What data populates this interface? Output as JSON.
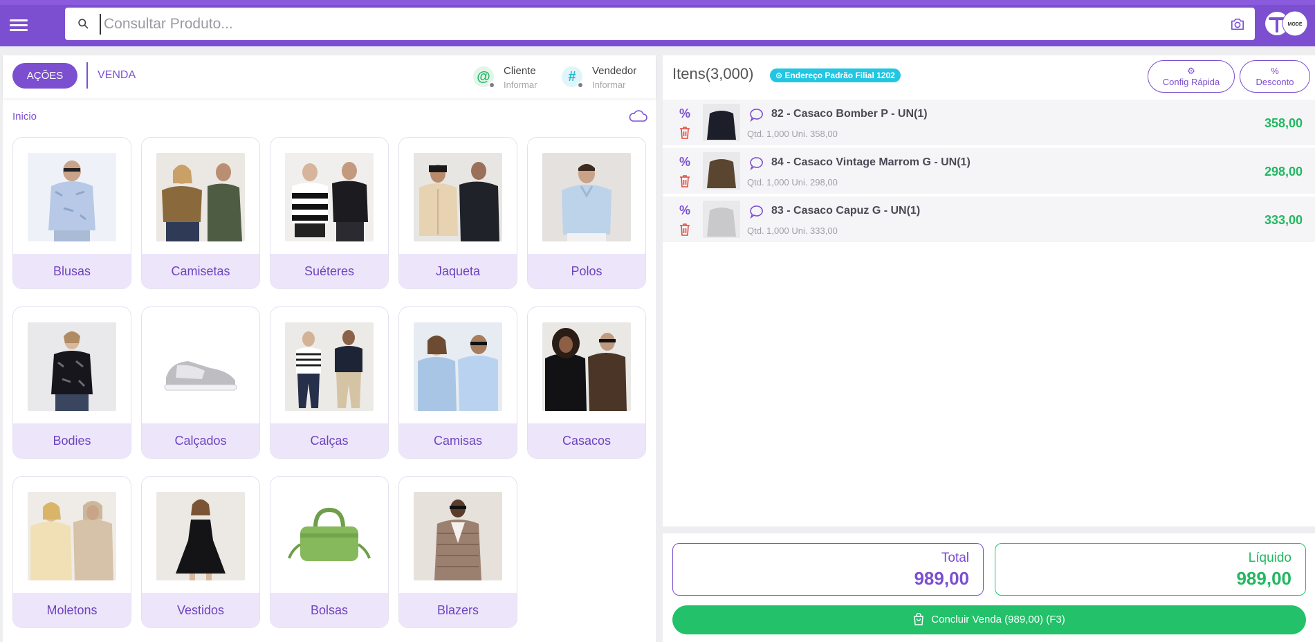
{
  "search": {
    "placeholder": "Consultar Produto..."
  },
  "brand": {
    "logo_text": "MODE"
  },
  "toolbar": {
    "actions_label": "AÇÕES",
    "sale_tab": "VENDA",
    "customer": {
      "title": "Cliente",
      "value": "Informar"
    },
    "seller": {
      "title": "Vendedor",
      "value": "Informar"
    }
  },
  "breadcrumb": "Inicio",
  "categories": [
    {
      "label": "Blusas",
      "icon": "blouse-photo"
    },
    {
      "label": "Camisetas",
      "icon": "tshirt-photo"
    },
    {
      "label": "Suéteres",
      "icon": "sweater-photo"
    },
    {
      "label": "Jaqueta",
      "icon": "jacket-photo"
    },
    {
      "label": "Polos",
      "icon": "polo-photo"
    },
    {
      "label": "Bodies",
      "icon": "bodysuit-photo"
    },
    {
      "label": "Calçados",
      "icon": "sneaker-photo"
    },
    {
      "label": "Calças",
      "icon": "pants-photo"
    },
    {
      "label": "Camisas",
      "icon": "shirt-photo"
    },
    {
      "label": "Casacos",
      "icon": "coat-photo"
    },
    {
      "label": "Moletons",
      "icon": "hoodie-photo"
    },
    {
      "label": "Vestidos",
      "icon": "dress-photo"
    },
    {
      "label": "Bolsas",
      "icon": "bag-photo"
    },
    {
      "label": "Blazers",
      "icon": "blazer-photo"
    }
  ],
  "cart": {
    "title": "Itens(3,000)",
    "address_badge": "Endereço Padrão Filial 1202",
    "quick_config_label": "Config Rápida",
    "discount_label": "Desconto",
    "items": [
      {
        "name": "82 - Casaco Bomber P - UN(1)",
        "meta": "Qtd. 1,000  Uni. 358,00",
        "price": "358,00",
        "thumb_color": "#1c1f2a"
      },
      {
        "name": "84 - Casaco Vintage Marrom G - UN(1)",
        "meta": "Qtd. 1,000  Uni. 298,00",
        "price": "298,00",
        "thumb_color": "#5a4630"
      },
      {
        "name": "83 - Casaco Capuz G - UN(1)",
        "meta": "Qtd. 1,000  Uni. 333,00",
        "price": "333,00",
        "thumb_color": "#c9c9cc"
      }
    ]
  },
  "totals": {
    "total_label": "Total",
    "total_value": "989,00",
    "net_label": "Líquido",
    "net_value": "989,00",
    "conclude_label": "Concluir Venda (989,00) (F3)"
  },
  "colors": {
    "accent": "#7c4fd0",
    "accent_light": "#ede6fa",
    "success": "#22c16a",
    "price": "#22b860",
    "badge": "#22c6e3",
    "danger": "#e0483d"
  }
}
